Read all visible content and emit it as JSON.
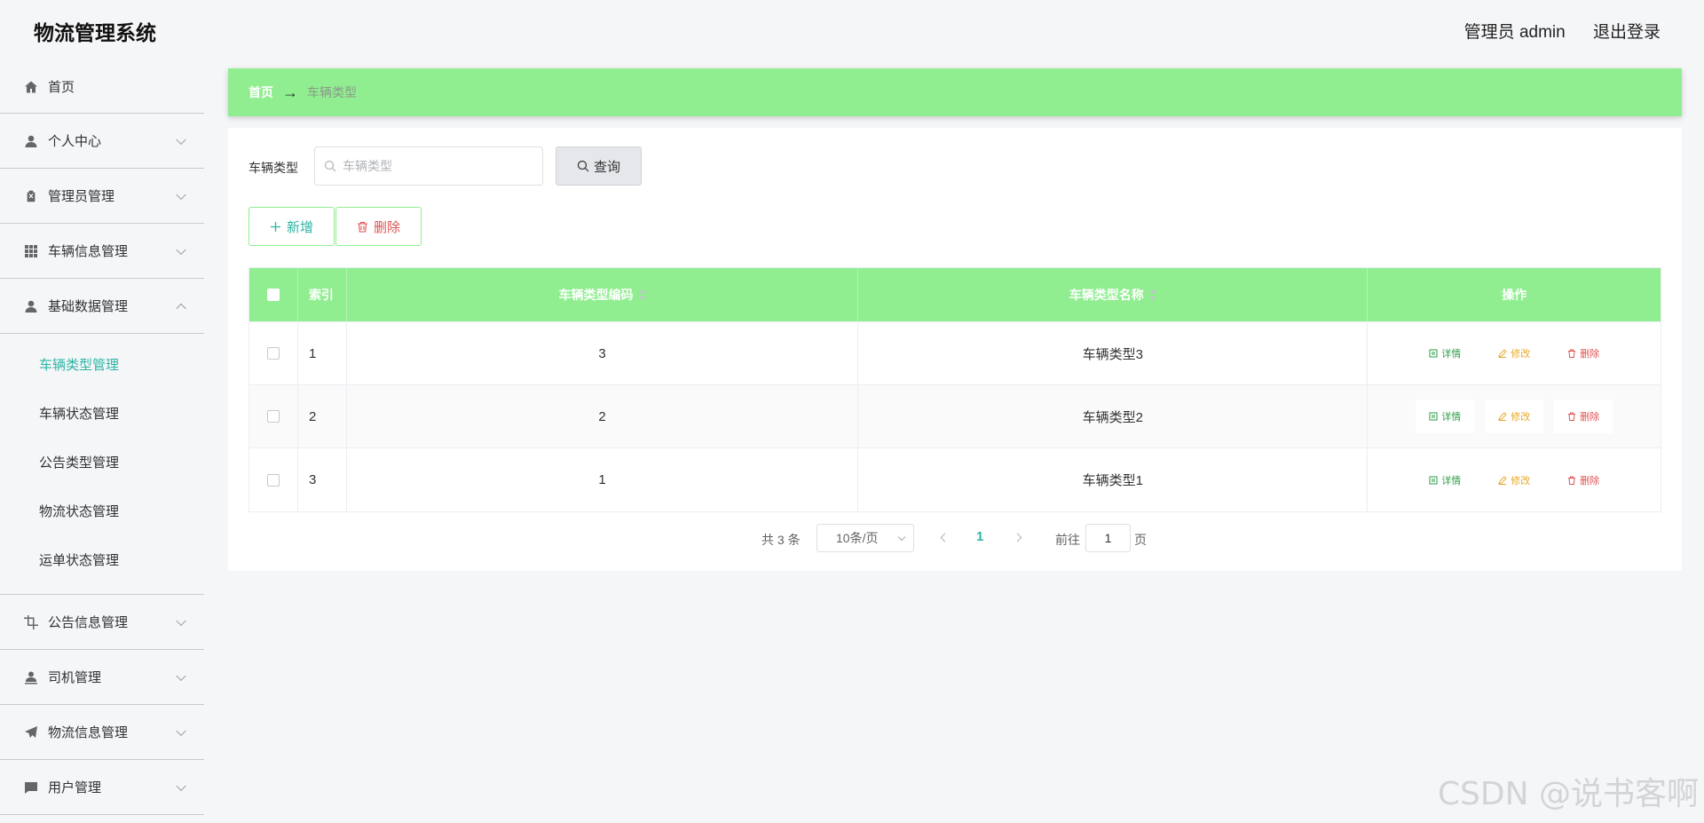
{
  "header": {
    "app_title": "物流管理系统",
    "user_label": "管理员 admin",
    "logout_label": "退出登录"
  },
  "sidebar": {
    "items": [
      {
        "label": "首页",
        "icon": "home-icon"
      },
      {
        "label": "个人中心",
        "icon": "user-icon"
      },
      {
        "label": "管理员管理",
        "icon": "clipboard-icon"
      },
      {
        "label": "车辆信息管理",
        "icon": "grid-icon"
      },
      {
        "label": "基础数据管理",
        "icon": "user-icon",
        "expanded": true,
        "children": [
          "车辆类型管理",
          "车辆状态管理",
          "公告类型管理",
          "物流状态管理",
          "运单状态管理"
        ]
      },
      {
        "label": "公告信息管理",
        "icon": "crop-icon"
      },
      {
        "label": "司机管理",
        "icon": "driver-icon"
      },
      {
        "label": "物流信息管理",
        "icon": "send-icon"
      },
      {
        "label": "用户管理",
        "icon": "chat-icon"
      }
    ],
    "active_child": "车辆类型管理"
  },
  "breadcrumb": {
    "home": "首页",
    "arrow": "→",
    "current": "车辆类型"
  },
  "search": {
    "label": "车辆类型",
    "placeholder": "车辆类型",
    "button": "查询"
  },
  "actions": {
    "add": "新增",
    "delete": "删除"
  },
  "table": {
    "headers": {
      "index": "索引",
      "code": "车辆类型编码",
      "name": "车辆类型名称",
      "ops": "操作"
    },
    "rows": [
      {
        "index": "1",
        "code": "3",
        "name": "车辆类型3"
      },
      {
        "index": "2",
        "code": "2",
        "name": "车辆类型2"
      },
      {
        "index": "3",
        "code": "1",
        "name": "车辆类型1"
      }
    ],
    "op_labels": {
      "detail": "详情",
      "edit": "修改",
      "remove": "删除"
    }
  },
  "pagination": {
    "total": "共 3 条",
    "page_size": "10条/页",
    "current_page": "1",
    "goto_label": "前往",
    "goto_value": "1",
    "page_suffix": "页"
  },
  "watermark": "CSDN @说书客啊",
  "colors": {
    "accent_green": "#90ee90",
    "active_teal": "#2cb5a6",
    "danger": "#e05252",
    "warning": "#e8a92b"
  }
}
